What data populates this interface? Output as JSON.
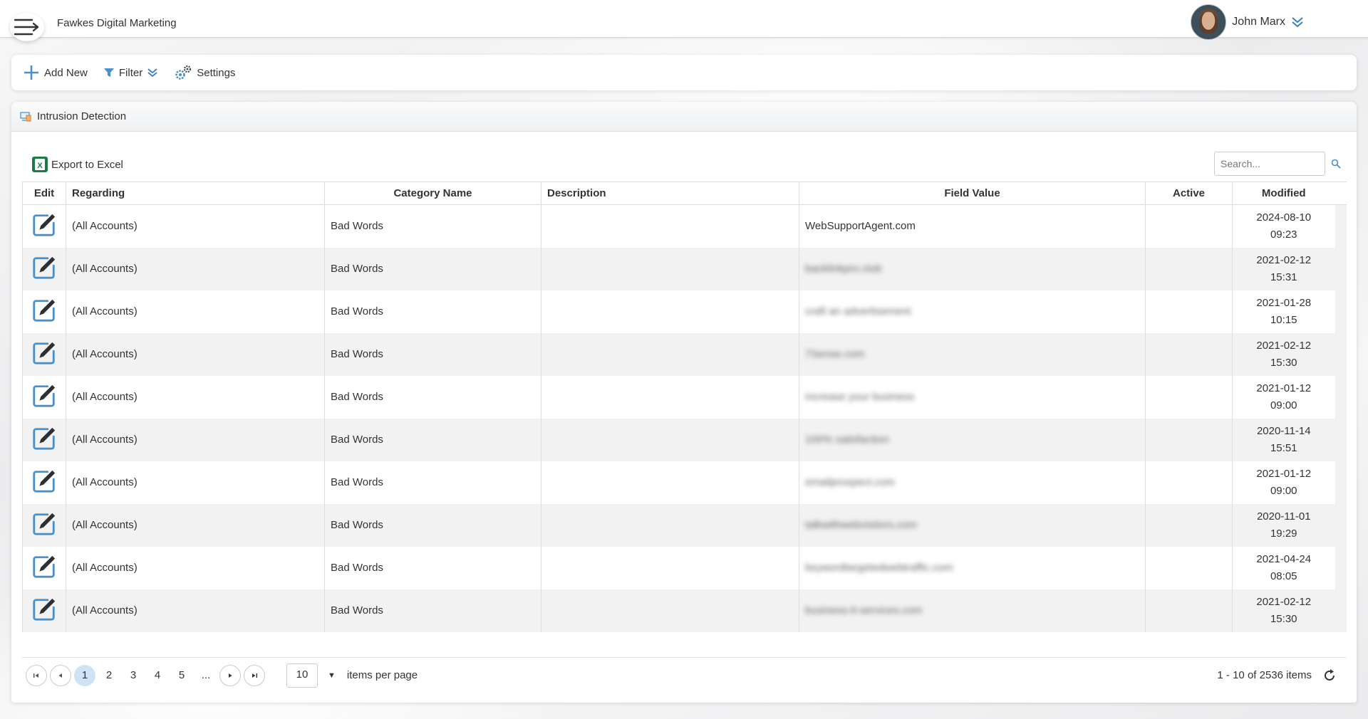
{
  "app": {
    "title": "Fawkes Digital Marketing"
  },
  "user": {
    "name": "John Marx"
  },
  "toolbar": {
    "add_new": "Add New",
    "filter": "Filter",
    "settings": "Settings"
  },
  "panel": {
    "title": "Intrusion Detection"
  },
  "actions": {
    "export": "Export to Excel"
  },
  "search": {
    "placeholder": "Search..."
  },
  "grid": {
    "columns": [
      "Edit",
      "Regarding",
      "Category Name",
      "Description",
      "Field Value",
      "Active",
      "Modified"
    ],
    "rows": [
      {
        "regarding": "(All Accounts)",
        "category": "Bad Words",
        "description": "",
        "field_value": "WebSupportAgent.com",
        "active": "",
        "modified_date": "2024-08-10",
        "modified_time": "09:23"
      },
      {
        "regarding": "(All Accounts)",
        "category": "Bad Words",
        "description": "",
        "field_value": "backlinkpro.club",
        "active": "",
        "modified_date": "2021-02-12",
        "modified_time": "15:31"
      },
      {
        "regarding": "(All Accounts)",
        "category": "Bad Words",
        "description": "",
        "field_value": "craft an advertisement",
        "active": "",
        "modified_date": "2021-01-28",
        "modified_time": "10:15"
      },
      {
        "regarding": "(All Accounts)",
        "category": "Bad Words",
        "description": "",
        "field_value": "7Sense.com",
        "active": "",
        "modified_date": "2021-02-12",
        "modified_time": "15:30"
      },
      {
        "regarding": "(All Accounts)",
        "category": "Bad Words",
        "description": "",
        "field_value": "increase your business",
        "active": "",
        "modified_date": "2021-01-12",
        "modified_time": "09:00"
      },
      {
        "regarding": "(All Accounts)",
        "category": "Bad Words",
        "description": "",
        "field_value": "100% satisfaction",
        "active": "",
        "modified_date": "2020-11-14",
        "modified_time": "15:51"
      },
      {
        "regarding": "(All Accounts)",
        "category": "Bad Words",
        "description": "",
        "field_value": "emailprospect.com",
        "active": "",
        "modified_date": "2021-01-12",
        "modified_time": "09:00"
      },
      {
        "regarding": "(All Accounts)",
        "category": "Bad Words",
        "description": "",
        "field_value": "talkwithwebvisitors.com",
        "active": "",
        "modified_date": "2020-11-01",
        "modified_time": "19:29"
      },
      {
        "regarding": "(All Accounts)",
        "category": "Bad Words",
        "description": "",
        "field_value": "keywordtargetedwebtraffic.com",
        "active": "",
        "modified_date": "2021-04-24",
        "modified_time": "08:05"
      },
      {
        "regarding": "(All Accounts)",
        "category": "Bad Words",
        "description": "",
        "field_value": "business-it-services.com",
        "active": "",
        "modified_date": "2021-02-12",
        "modified_time": "15:30"
      }
    ]
  },
  "pager": {
    "pages": [
      "1",
      "2",
      "3",
      "4",
      "5",
      "..."
    ],
    "current_page": "1",
    "page_size": "10",
    "page_size_label": "items per page",
    "info": "1 - 10 of 2536 items"
  },
  "colors": {
    "accent": "#4a90c8",
    "active_page": "#cfe3f7",
    "excel_green": "#1f7a45"
  },
  "icons": {
    "menu": "menu-arrow-icon",
    "user_dropdown": "chevron-double-down-icon",
    "add": "plus-icon",
    "filter": "funnel-icon",
    "settings": "gears-icon",
    "panel": "monitor-icon",
    "excel": "excel-icon",
    "search": "magnifier-icon",
    "edit": "edit-pencil-icon",
    "refresh": "refresh-icon"
  }
}
